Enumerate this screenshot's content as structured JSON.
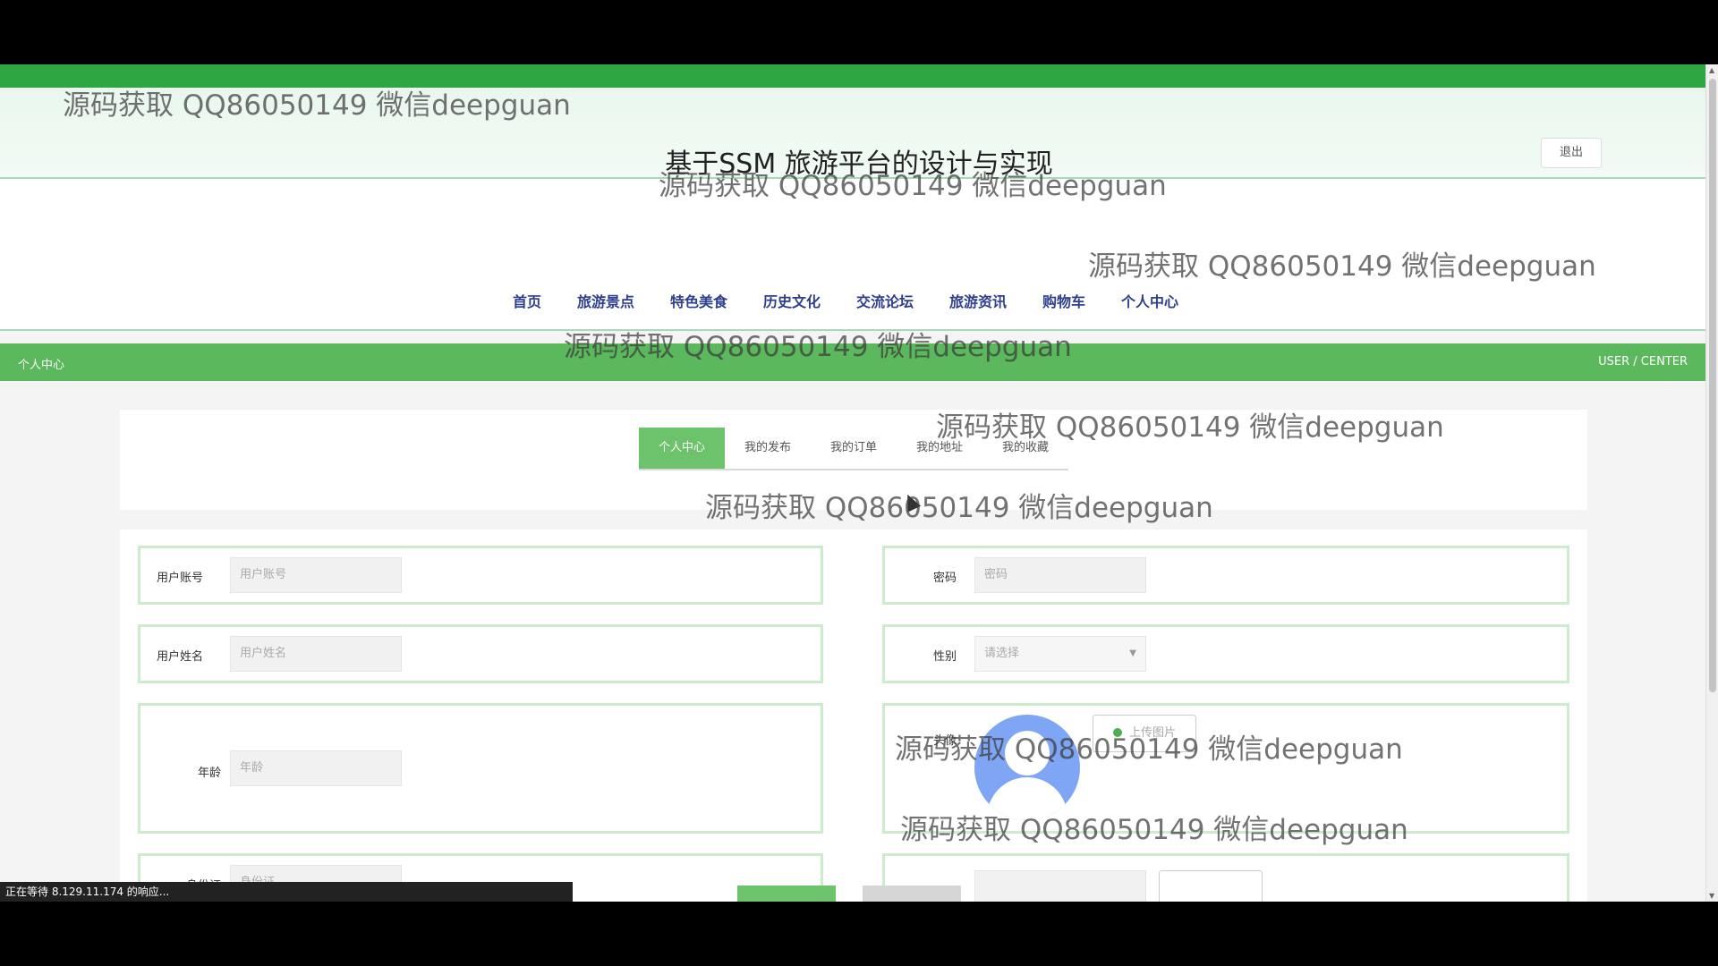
{
  "header": {
    "title": "基于SSM 旅游平台的设计与实现",
    "logout_label": "退出"
  },
  "nav": {
    "items": [
      "首页",
      "旅游景点",
      "特色美食",
      "历史文化",
      "交流论坛",
      "旅游资讯",
      "购物车",
      "个人中心"
    ]
  },
  "section": {
    "left": "个人中心",
    "right": "USER / CENTER"
  },
  "tabs": {
    "items": [
      "个人中心",
      "我的发布",
      "我的订单",
      "我的地址",
      "我的收藏"
    ],
    "active": "个人中心"
  },
  "form": {
    "account_label": "用户账号",
    "account_placeholder": "用户账号",
    "password_label": "密码",
    "password_placeholder": "密码",
    "name_label": "用户姓名",
    "name_placeholder": "用户姓名",
    "gender_label": "性别",
    "gender_value": "请选择",
    "age_label": "年龄",
    "age_placeholder": "年龄",
    "avatar_label": "头像",
    "upload_label": "上传图片",
    "idcard_label": "身份证",
    "idcard_placeholder": "身份证"
  },
  "status": {
    "text": "正在等待 8.129.11.174 的响应..."
  },
  "watermark": {
    "text": "源码获取 QQ86050149 微信deepguan"
  }
}
